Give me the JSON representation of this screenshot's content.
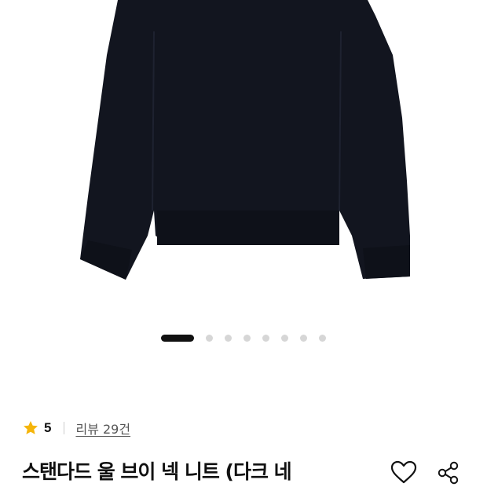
{
  "product": {
    "image": {
      "subject": "sweater-photo",
      "garment_color": "#12151f",
      "background_color": "#ffffff"
    },
    "carousel": {
      "total_slides": 8,
      "active_index": 0,
      "active_color": "#111111",
      "inactive_color": "#d6d6d6"
    },
    "rating": {
      "icon": "star-icon",
      "star_color": "#f5b50a",
      "value": "5",
      "review_label": "리뷰 29건"
    },
    "title": "스탠다드 울 브이 넥 니트 (다크 네",
    "actions": {
      "like_icon": "heart-icon",
      "share_icon": "share-icon"
    }
  }
}
